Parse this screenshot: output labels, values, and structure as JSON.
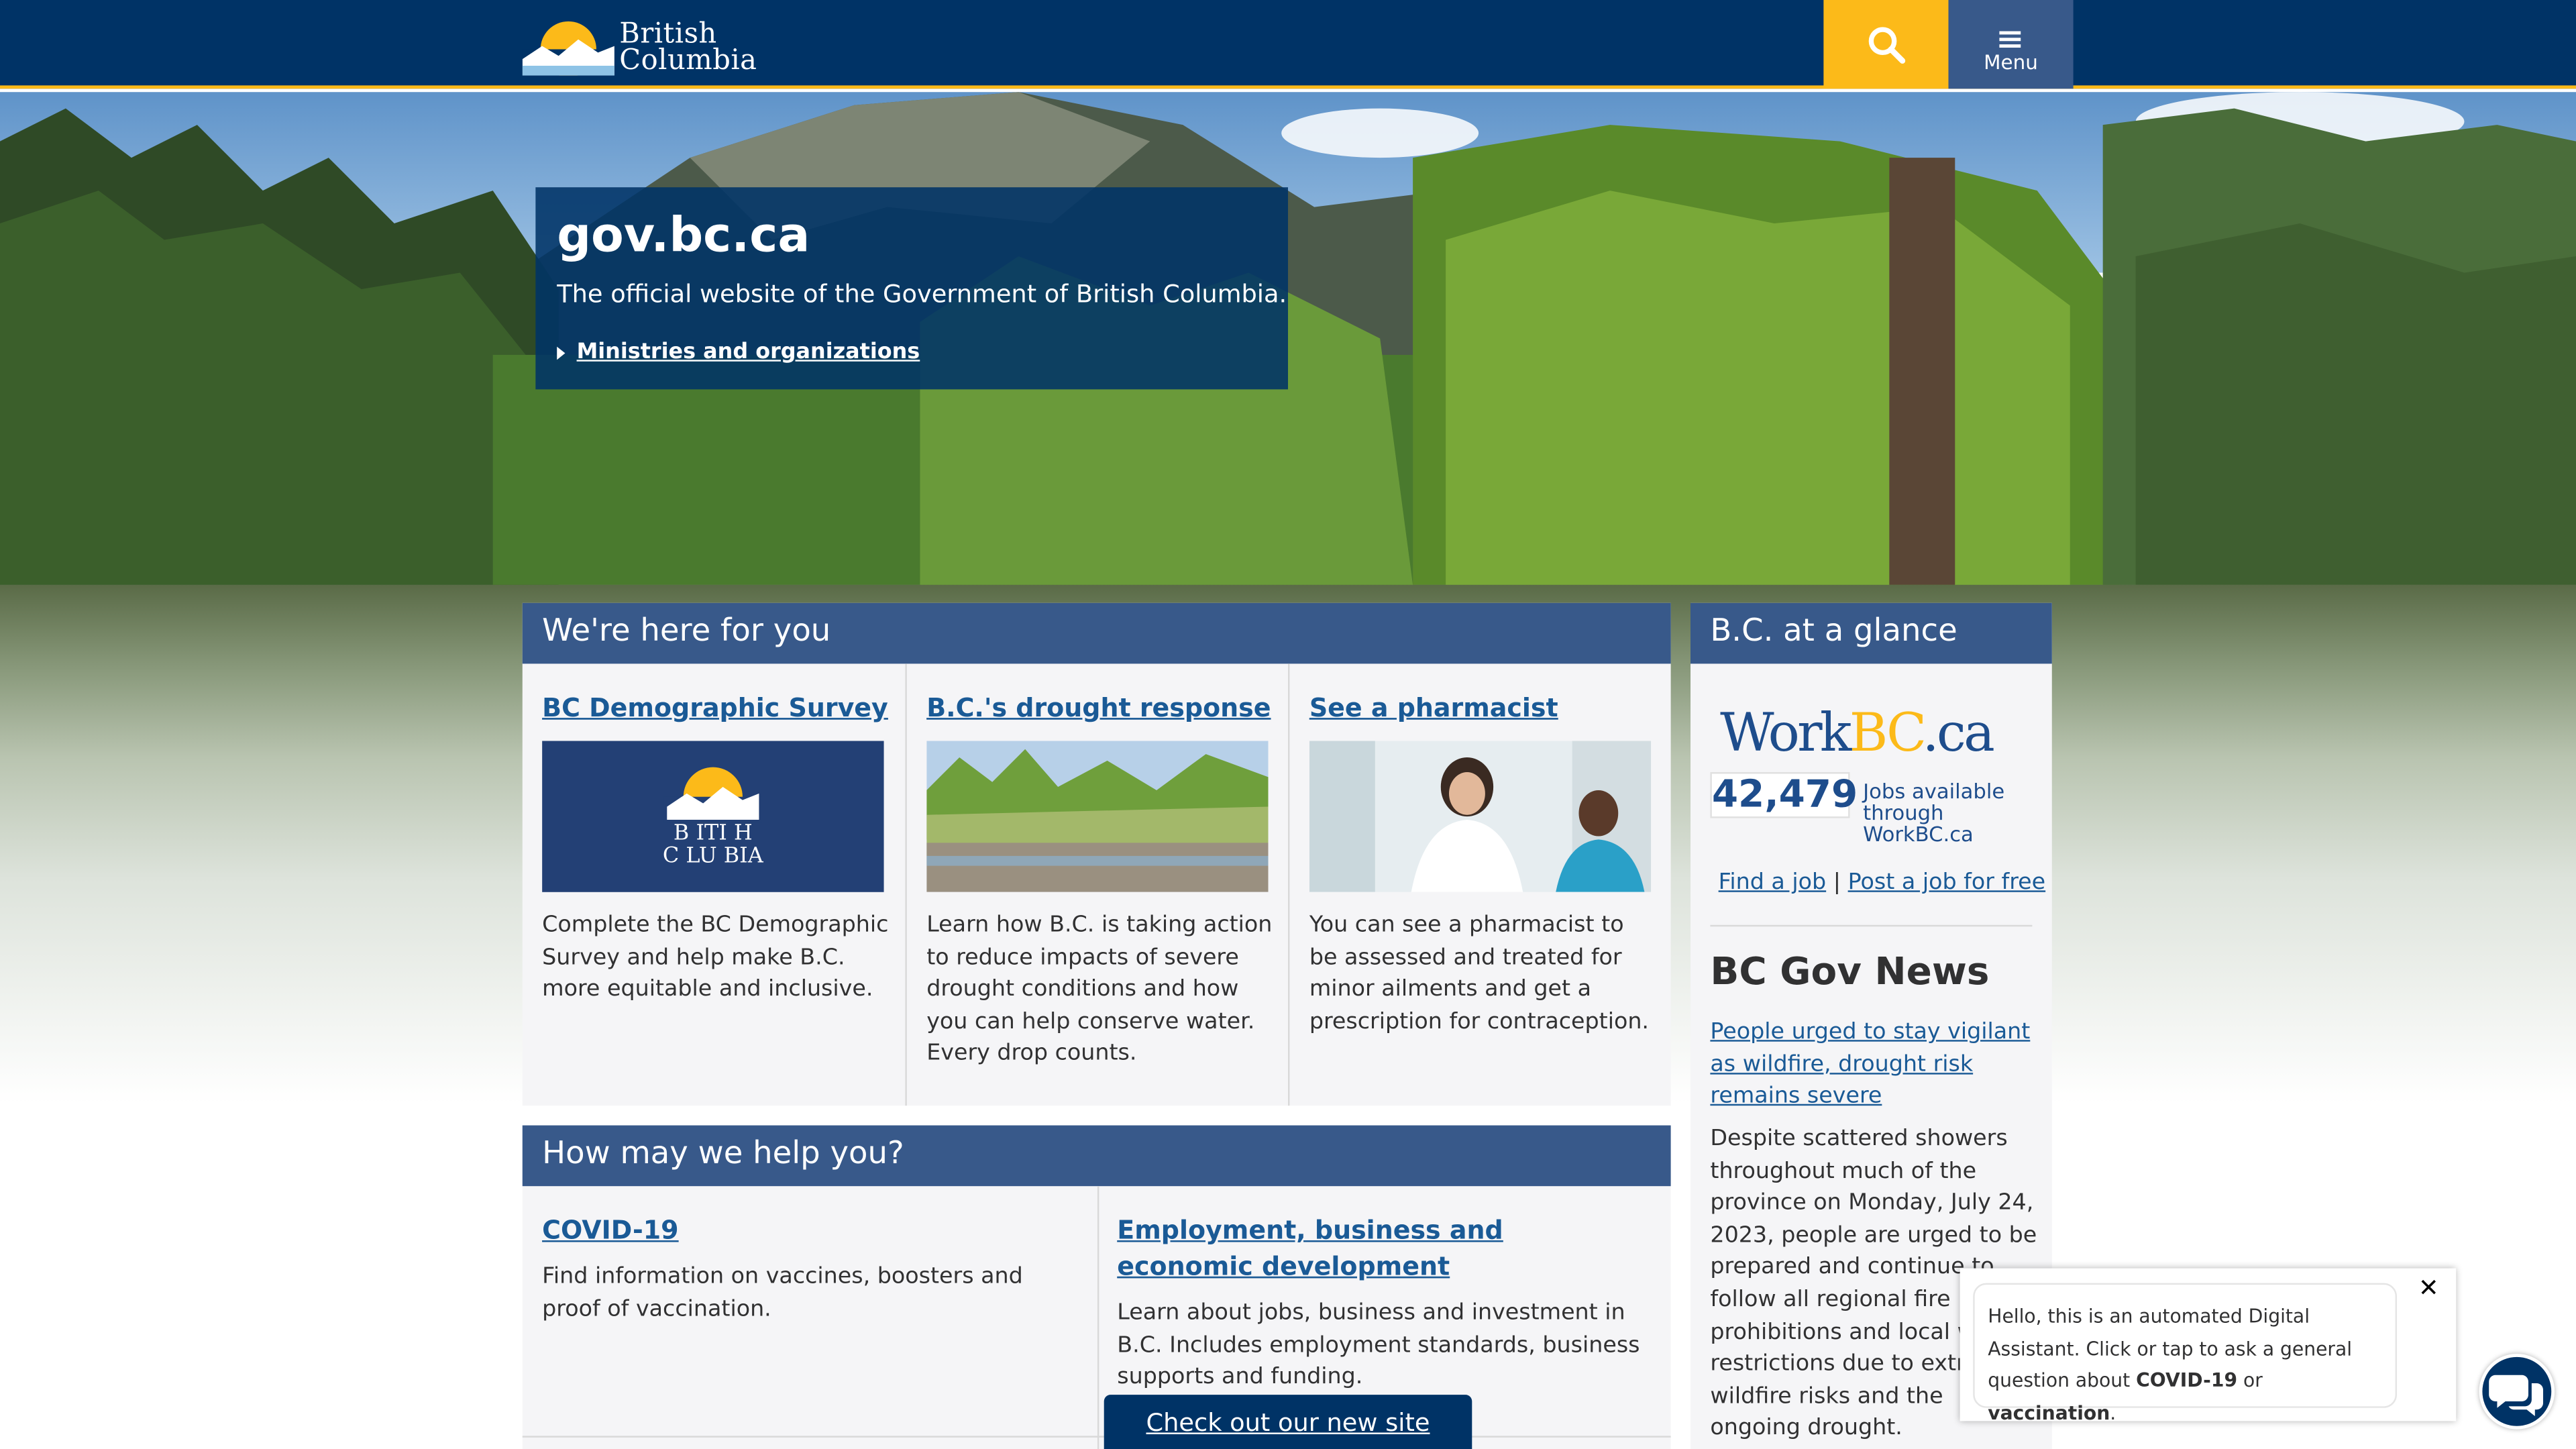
{
  "header": {
    "logo_line1": "British",
    "logo_line2": "Columbia",
    "search_icon": "search-icon",
    "menu_label": "Menu"
  },
  "intro": {
    "title": "gov.bc.ca",
    "subtitle": "The official website of the Government of British Columbia.",
    "link": "Ministries and organizations"
  },
  "here_for_you": {
    "title": "We're here for you",
    "cards": [
      {
        "title": "BC Demographic Survey",
        "text": "Complete the BC Demographic Survey and help make B.C. more equitable and inclusive.",
        "img_line1": "B   ITI   H",
        "img_line2": "C   LU   BIA"
      },
      {
        "title": "B.C.'s drought response",
        "text": "Learn how B.C. is taking action to reduce impacts of severe drought conditions and how you can help conserve water. Every drop counts."
      },
      {
        "title": "See a pharmacist",
        "text": "You can see a pharmacist to be assessed and treated for minor ailments and get a prescription for contraception."
      }
    ]
  },
  "help": {
    "title": "How may we help you?",
    "items": [
      {
        "title": "COVID-19",
        "text": "Find information on vaccines, boosters and proof of vaccination."
      },
      {
        "title": "Employment, business and economic development",
        "text": "Learn about jobs, business and investment in B.C. Includes employment standards, business supports and funding."
      }
    ]
  },
  "glance": {
    "title": "B.C. at a glance",
    "workbc_a": "Work",
    "workbc_b": "BC",
    "workbc_c": ".ca",
    "jobs_count": "42,479",
    "jobs_label": "Jobs available through WorkBC.ca",
    "find_job": "Find a job",
    "separator": "|",
    "post_job": "Post a job for free",
    "news_title": "BC Gov News",
    "news_link": "People urged to stay vigilant as wildfire, drought risk remains severe",
    "news_body": "Despite scattered showers throughout much of the province on Monday, July 24, 2023, people are urged to be prepared and continue to follow all regional fire prohibitions and local water restrictions due to extreme wildfire risks and the ongoing drought."
  },
  "chat": {
    "text_pre": "Hello, this is an automated Digital Assistant. Click or tap to ask a general question about ",
    "kw1": "COVID-19",
    "mid": " or ",
    "kw2": "vaccination",
    "end": ".",
    "close": "✕"
  },
  "new_site": "Check out our new site",
  "colors": {
    "navy": "#003366",
    "gold": "#fcba19",
    "panel_blue": "#38598a",
    "link": "#1a5a96"
  }
}
